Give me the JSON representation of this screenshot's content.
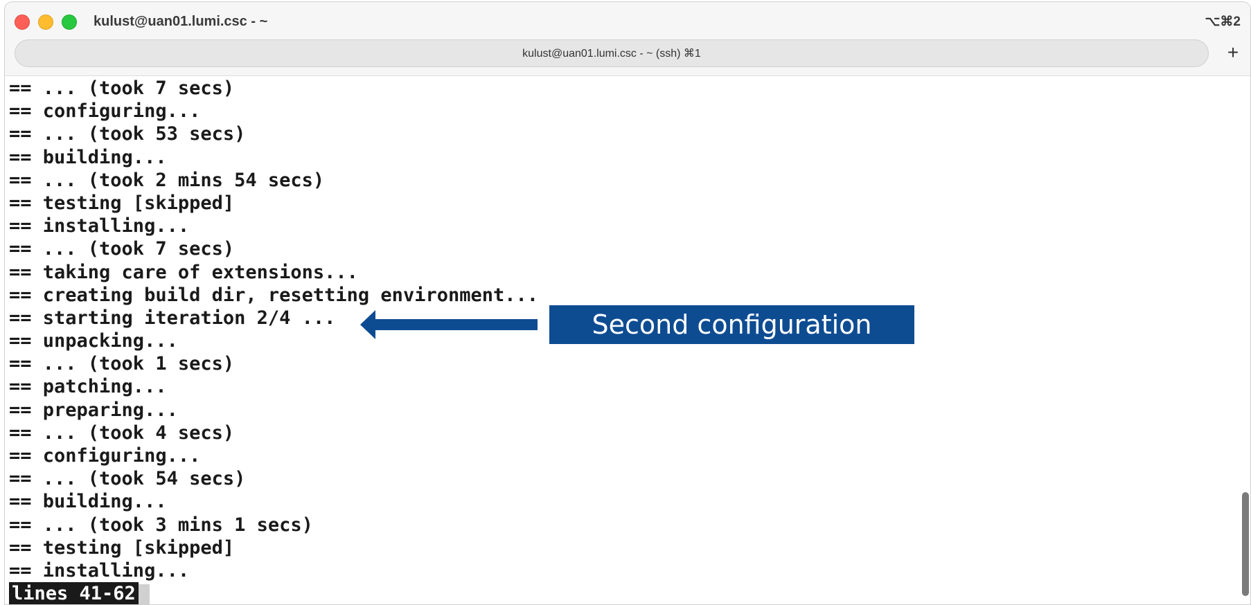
{
  "window": {
    "title": "kulust@uan01.lumi.csc - ~",
    "shortcut": "⌥⌘2"
  },
  "tab": {
    "label": "kulust@uan01.lumi.csc - ~ (ssh) ⌘1",
    "add_label": "+"
  },
  "terminal": {
    "lines": [
      "== ... (took 7 secs)",
      "== configuring...",
      "== ... (took 53 secs)",
      "== building...",
      "== ... (took 2 mins 54 secs)",
      "== testing [skipped]",
      "== installing...",
      "== ... (took 7 secs)",
      "== taking care of extensions...",
      "== creating build dir, resetting environment...",
      "== starting iteration 2/4 ...",
      "== unpacking...",
      "== ... (took 1 secs)",
      "== patching...",
      "== preparing...",
      "== ... (took 4 secs)",
      "== configuring...",
      "== ... (took 54 secs)",
      "== building...",
      "== ... (took 3 mins 1 secs)",
      "== testing [skipped]",
      "== installing..."
    ],
    "status": "lines 41-62"
  },
  "annotation": {
    "text": "Second configuration",
    "color": "#0e4c92"
  },
  "icons": {
    "close": "close-icon",
    "minimize": "minimize-icon",
    "zoom": "zoom-icon",
    "arrow": "arrow-left-icon"
  }
}
